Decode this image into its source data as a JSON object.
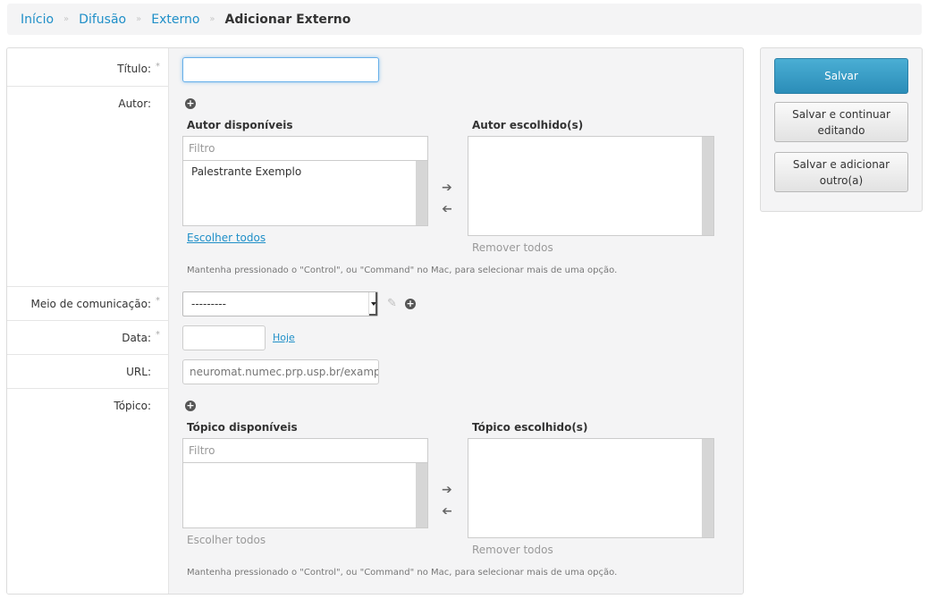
{
  "breadcrumb": {
    "items": [
      "Início",
      "Difusão",
      "Externo"
    ],
    "separator": "»",
    "current": "Adicionar Externo"
  },
  "form": {
    "required_mark": "*",
    "titulo": {
      "label": "Título:",
      "value": ""
    },
    "autor": {
      "label": "Autor:",
      "available_title": "Autor disponíveis",
      "chosen_title": "Autor escolhido(s)",
      "filter_placeholder": "Filtro",
      "available_options": [
        "Palestrante Exemplo"
      ],
      "choose_all": "Escolher todos",
      "remove_all": "Remover todos",
      "help": "Mantenha pressionado o \"Control\", ou \"Command\" no Mac, para selecionar mais de uma opção."
    },
    "meio": {
      "label": "Meio de comunicação:",
      "selected": "---------"
    },
    "data": {
      "label": "Data:",
      "value": "",
      "today_link": "Hoje"
    },
    "url": {
      "label": "URL:",
      "placeholder": "neuromat.numec.prp.usp.br/example"
    },
    "topico": {
      "label": "Tópico:",
      "available_title": "Tópico disponíveis",
      "chosen_title": "Tópico escolhido(s)",
      "filter_placeholder": "Filtro",
      "choose_all": "Escolher todos",
      "remove_all": "Remover todos",
      "help": "Mantenha pressionado o \"Control\", ou \"Command\" no Mac, para selecionar mais de uma opção."
    }
  },
  "actions": {
    "save": "Salvar",
    "save_continue": "Salvar e continuar editando",
    "save_add": "Salvar e adicionar outro(a)"
  },
  "icons": {
    "plus": "plus-circle-icon",
    "arrow_right": "arrow-right-icon",
    "arrow_left": "arrow-left-icon",
    "pencil": "pencil-icon"
  },
  "colors": {
    "link": "#1f8fc8",
    "primary_button": "#2b8db8",
    "panel_bg": "#f4f4f5"
  }
}
